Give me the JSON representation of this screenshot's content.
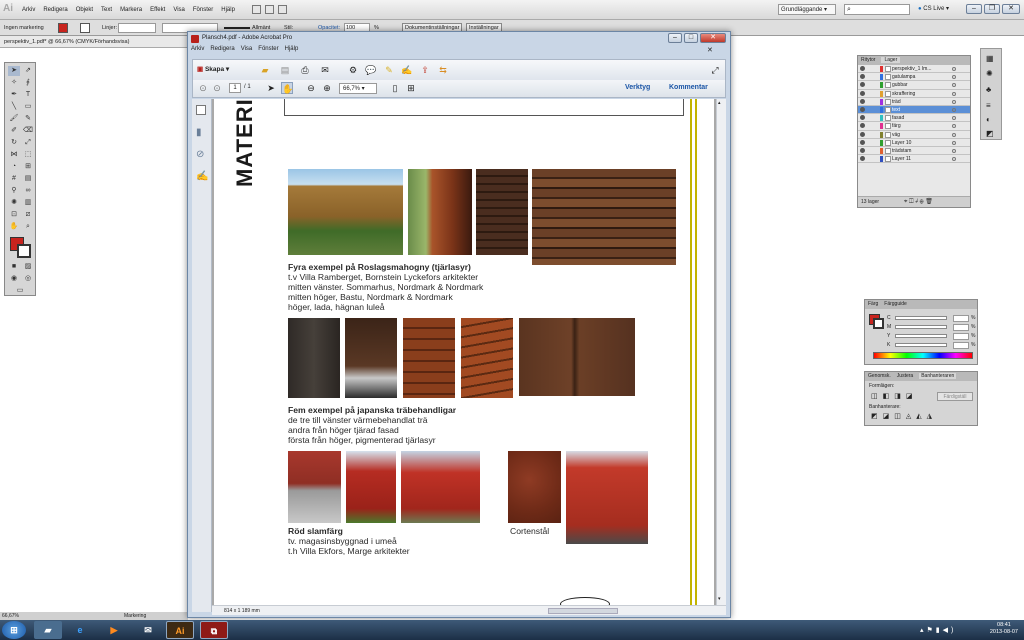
{
  "illustrator": {
    "logo": "Ai",
    "menus": [
      "Arkiv",
      "Redigera",
      "Objekt",
      "Text",
      "Markera",
      "Effekt",
      "Visa",
      "Fönster",
      "Hjälp"
    ],
    "workspace": "Grundläggande",
    "cs_live": "CS Live",
    "control": {
      "selection": "Ingen markering",
      "stroke_label": "Linjer:",
      "stroke_style": "Allmänt",
      "style_label": "Stil:",
      "opacity_label": "Opacitet:",
      "opacity_value": "100",
      "opacity_unit": "%",
      "doc_setup": "Dokumentinställningar",
      "prefs": "Inställningar"
    },
    "doc_tab": "perspektiv_1.pdf* @ 66,67% (CMYK/Förhandsvisa)",
    "zoom": "66,67%",
    "status": "Markering"
  },
  "acrobat": {
    "title": "Plansch4.pdf - Adobe Acrobat Pro",
    "menus": [
      "Arkiv",
      "Redigera",
      "Visa",
      "Fönster",
      "Hjälp"
    ],
    "create": "Skapa",
    "page_current": "1",
    "page_total": "/ 1",
    "zoom": "66,7%",
    "tools": "Verktyg",
    "comment": "Kommentar",
    "page_size": "814 x 1 189 mm"
  },
  "document": {
    "heading": "MATERIAL",
    "section1": {
      "title": "Fyra exempel på Roslagsmahogny (tjärlasyr)",
      "lines": [
        "t.v Villa Ramberget, Bornstein Lyckefors arkitekter",
        "mitten vänster. Sommarhus, Nordmark & Nordmark",
        "mitten höger, Bastu, Nordmark & Nordmark",
        "höger, lada, hägnan luleå"
      ]
    },
    "section2": {
      "title": "Fem exempel på japanska träbehandligar",
      "lines": [
        "de tre till vänster värmebehandlat trä",
        "andra från höger tjärad fasad",
        "första från höger, pigmenterad tjärlasyr"
      ]
    },
    "section3": {
      "title": "Röd slamfärg",
      "lines": [
        "tv. magasinsbyggnad i umeå",
        "t.h Villa Ekfors, Marge arkitekter"
      ]
    },
    "corten": "Cortenstål"
  },
  "layers_panel": {
    "tabs": [
      "Ritytor",
      "Lager"
    ],
    "layers": [
      "perspektiv_1 Im...",
      "gatulampa",
      "gubbar",
      "skraffering",
      "träd",
      "text",
      "fasad",
      "färg",
      "väg",
      "Layer 10",
      "trädstam",
      "Layer 11"
    ],
    "selected_index": 5,
    "footer": "13 lager"
  },
  "color_panel": {
    "tabs": [
      "Färg",
      "Färgguide"
    ],
    "channels": [
      "C",
      "M",
      "Y",
      "K"
    ],
    "unit": "%"
  },
  "transparency_panel": {
    "tabs": [
      "Genomsk.",
      "Justera",
      "Banhanteraren"
    ],
    "shape_label": "Formlägen:",
    "expand": "Färdigställ",
    "path_label": "Banhanterare:"
  },
  "taskbar": {
    "time": "08:41",
    "date": "2013-08-07"
  },
  "colors": {
    "ai_swatch_red": "#c8241e",
    "acrobat_border": "#6c86a5",
    "layer_selected": "#5b8fd6",
    "olive_line": "#c2b400",
    "close_red": "#d9493a"
  }
}
